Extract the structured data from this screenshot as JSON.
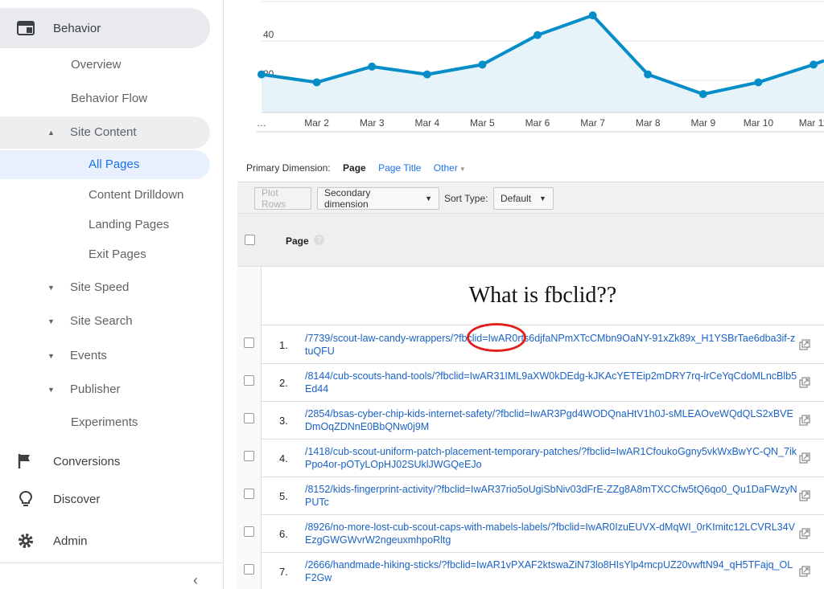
{
  "sidebar": {
    "behavior": "Behavior",
    "overview": "Overview",
    "behavior_flow": "Behavior Flow",
    "site_content": "Site Content",
    "all_pages": "All Pages",
    "content_drilldown": "Content Drilldown",
    "landing_pages": "Landing Pages",
    "exit_pages": "Exit Pages",
    "site_speed": "Site Speed",
    "site_search": "Site Search",
    "events": "Events",
    "publisher": "Publisher",
    "experiments": "Experiments",
    "conversions": "Conversions",
    "discover": "Discover",
    "admin": "Admin",
    "expanded_marker": "▲",
    "collapsed_marker": "▼",
    "collapse_glyph": "‹"
  },
  "chart_data": {
    "type": "area",
    "categories": [
      "…",
      "Mar 2",
      "Mar 3",
      "Mar 4",
      "Mar 5",
      "Mar 6",
      "Mar 7",
      "Mar 8",
      "Mar 9",
      "Mar 10",
      "Mar 11"
    ],
    "values": [
      23,
      19,
      27,
      23,
      28,
      43,
      53,
      23,
      13,
      19,
      28
    ],
    "y_ticks": [
      "20",
      "40",
      "60"
    ],
    "ylim": [
      0,
      60
    ],
    "line_color": "#058dc7",
    "fill_color": "#e6f4fa"
  },
  "primary_dimension": {
    "label": "Primary Dimension:",
    "active": "Page",
    "option_title": "Page Title",
    "option_other": "Other"
  },
  "toolbar": {
    "plot_rows": "Plot Rows",
    "secondary_dimension": "Secondary dimension",
    "sort_type_label": "Sort Type:",
    "sort_type_value": "Default"
  },
  "table": {
    "header_page": "Page",
    "help_glyph": "?",
    "annotation": "What is fbclid??",
    "rows": [
      {
        "num": "1.",
        "url": "/7739/scout-law-candy-wrappers/?fbclid=IwAR0rts6djfaNPmXTcCMbn9OaNY-91xZk89x_H1YSBrTae6dba3if-ztuQFU"
      },
      {
        "num": "2.",
        "url": "/8144/cub-scouts-hand-tools/?fbclid=IwAR31IML9aXW0kDEdg-kJKAcYETEip2mDRY7rq-lrCeYqCdoMLncBlb5Ed44"
      },
      {
        "num": "3.",
        "url": "/2854/bsas-cyber-chip-kids-internet-safety/?fbclid=IwAR3Pgd4WODQnaHtV1h0J-sMLEAOveWQdQLS2xBVEDmOqZDNnE0BbQNw0j9M"
      },
      {
        "num": "4.",
        "url": "/1418/cub-scout-uniform-patch-placement-temporary-patches/?fbclid=IwAR1CfoukoGgny5vkWxBwYC-QN_7ikPpo4or-pOTyLOpHJ02SUklJWGQeEJo"
      },
      {
        "num": "5.",
        "url": "/8152/kids-fingerprint-activity/?fbclid=IwAR37rio5oUgiSbNiv03dFrE-ZZg8A8mTXCCfw5tQ6qo0_Qu1DaFWzyNPUTc"
      },
      {
        "num": "6.",
        "url": "/8926/no-more-lost-cub-scout-caps-with-mabels-labels/?fbclid=IwAR0IzuEUVX-dMqWI_0rKImitc12LCVRL34VEzgGWGWvrW2ngeuxmhpoRltg"
      },
      {
        "num": "7.",
        "url": "/2666/handmade-hiking-sticks/?fbclid=IwAR1vPXAF2ktswaZiN73lo8HIsYlp4mcpUZ20vwftN94_qH5TFajq_OLF2Gw"
      }
    ]
  }
}
